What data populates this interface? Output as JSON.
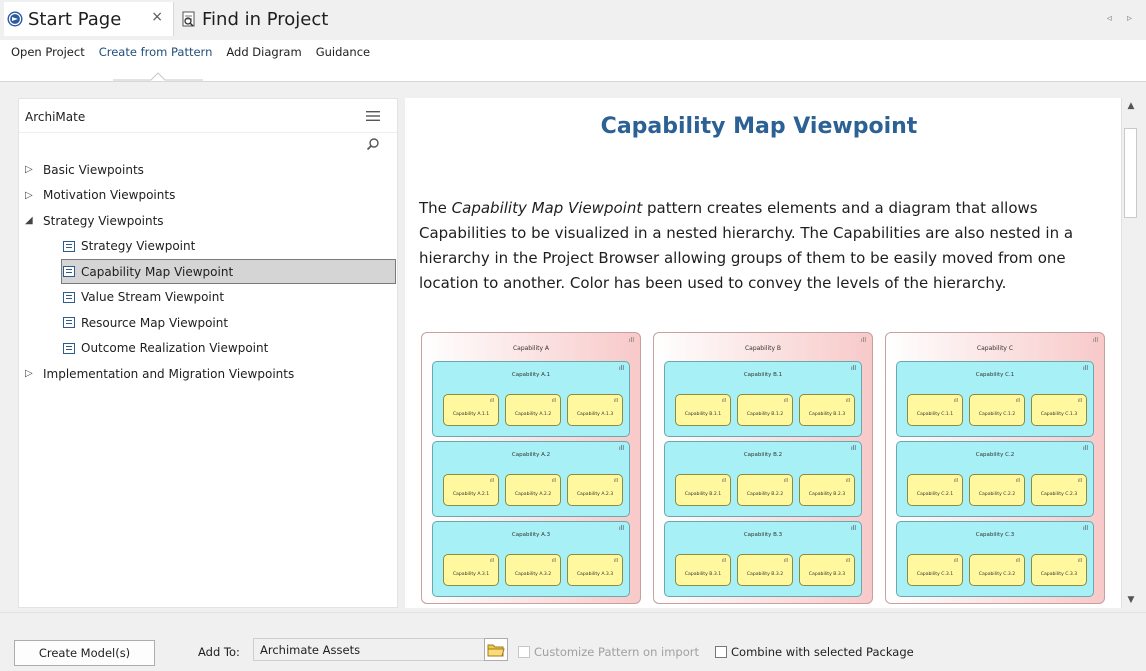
{
  "tabs": {
    "start_page": "Start Page",
    "close": "×",
    "find_in_project": "Find in Project",
    "nav_arrows": "◃ ▹"
  },
  "toolbar": {
    "links": [
      "Open Project",
      "Create from Pattern",
      "Add Diagram",
      "Guidance"
    ],
    "active_index": 1
  },
  "sidebar": {
    "title": "ArchiMate",
    "items": [
      {
        "label": "Basic Viewpoints",
        "expander": "▷"
      },
      {
        "label": "Motivation Viewpoints",
        "expander": "▷"
      },
      {
        "label": "Strategy Viewpoints",
        "expander": "◢"
      },
      {
        "label": "Strategy Viewpoint"
      },
      {
        "label": "Capability Map Viewpoint"
      },
      {
        "label": "Value Stream Viewpoint"
      },
      {
        "label": "Resource Map Viewpoint"
      },
      {
        "label": "Outcome Realization Viewpoint"
      },
      {
        "label": "Implementation and Migration Viewpoints",
        "expander": "▷"
      }
    ]
  },
  "content": {
    "title": "Capability Map Viewpoint",
    "description_pre": "The ",
    "description_em": "Capability Map Viewpoint",
    "description_post": " pattern creates elements and a diagram that allows Capabilities to be visualized in a nested hierarchy. The Capabilities are also nested in a hierarchy in the Project Browser allowing groups of them to be easily moved from one location to another. Color has been used to convey the levels of the hierarchy.",
    "diagram": {
      "icon": "ıll",
      "groups": [
        {
          "label": "Capability A",
          "children": [
            {
              "label": "Capability A.1",
              "children": [
                "Capability A.1.1",
                "Capability A.1.2",
                "Capability A.1.3"
              ]
            },
            {
              "label": "Capability A.2",
              "children": [
                "Capability A.2.1",
                "Capability A.2.2",
                "Capability A.2.3"
              ]
            },
            {
              "label": "Capability A.3",
              "children": [
                "Capability A.3.1",
                "Capability A.3.2",
                "Capability A.3.3"
              ]
            }
          ]
        },
        {
          "label": "Capability B",
          "children": [
            {
              "label": "Capability B.1",
              "children": [
                "Capability B.1.1",
                "Capability B.1.2",
                "Capability B.1.3"
              ]
            },
            {
              "label": "Capability B.2",
              "children": [
                "Capability B.2.1",
                "Capability B.2.2",
                "Capability B.2.3"
              ]
            },
            {
              "label": "Capability B.3",
              "children": [
                "Capability B.3.1",
                "Capability B.3.2",
                "Capability B.3.3"
              ]
            }
          ]
        },
        {
          "label": "Capability C",
          "children": [
            {
              "label": "Capability C.1",
              "children": [
                "Capability C.1.1",
                "Capability C.1.2",
                "Capability C.1.3"
              ]
            },
            {
              "label": "Capability C.2",
              "children": [
                "Capability C.2.1",
                "Capability C.2.2",
                "Capability C.2.3"
              ]
            },
            {
              "label": "Capability C.3",
              "children": [
                "Capability C.3.1",
                "Capability C.3.2",
                "Capability C.3.3"
              ]
            }
          ]
        }
      ]
    }
  },
  "footer": {
    "create_button": "Create Model(s)",
    "add_to_label": "Add To:",
    "add_to_value": "Archimate Assets",
    "customize_label": "Customize Pattern on import",
    "combine_label": "Combine with selected Package"
  },
  "colors": {
    "title_blue": "#2b6194",
    "selection_gray": "#d5d5d5",
    "level1": "#f8c9c9",
    "level2": "#a7f0f5",
    "level3": "#fff89e"
  }
}
